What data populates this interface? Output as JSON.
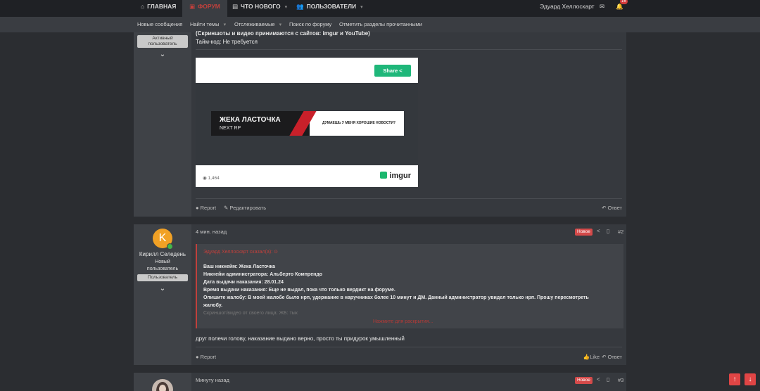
{
  "topnav": {
    "home": "ГЛАВНАЯ",
    "forum": "ФОРУМ",
    "whats_new": "ЧТО НОВОГО",
    "users": "ПОЛЬЗОВАТЕЛИ",
    "username": "Эдуард Хеллоскарт",
    "alerts_count": "16"
  },
  "subnav": {
    "items": [
      "Новые сообщения",
      "Найти темы",
      "Отслеживаемые",
      "Поиск по форуму",
      "Отметить разделы прочитанными"
    ]
  },
  "post1": {
    "user_title": "Активный пользователь",
    "line_top": "(Скриншоты и видео принимаются с сайтов: imgur и YouTube)",
    "line_timecode": "Тайм-код: Не требуется",
    "embed": {
      "share": "Share",
      "banner_title": "ЖЕКА ЛАСТОЧКА",
      "banner_sub": "NEXT RP",
      "banner_tag": "ДУМАЕШЬ У МЕНЯ ХОРОШИЕ НОВОСТИ?",
      "views": "1,464",
      "logo": "imgur"
    },
    "report": "Report",
    "edit": "Редактировать",
    "reply": "Ответ"
  },
  "post2": {
    "avatar_letter": "K",
    "username": "Кирилл Селедень",
    "user_title": "Новый пользователь",
    "user_tag": "Пользователь",
    "time": "4 мин. назад",
    "badge": "Новое",
    "num": "#2",
    "quote": {
      "author": "Эдуард Хеллоскарт сказал(а):",
      "lines": [
        "Ваш никнейм: Жека Ласточка",
        "Никнейм администратора: Альберто Компрендо",
        "Дата выдачи наказания: 28.01.24",
        "Время выдачи наказания: Еще не выдал, пока что только вердикт на форуме.",
        "Опишите жалобу: В моей жалобе было нрп, удержание в наручниках более 10 минут и ДМ. Данный администратор увидел только нрп. Прошу пересмотреть",
        "жалобу.",
        "Скриншот/видео от своего лица: ЖБ: тык"
      ],
      "expand": "Нажмите для раскрытия..."
    },
    "text": "друг полечи голову, наказание выдано верно, просто ты придурок умышленный",
    "report": "Report",
    "like": "Like",
    "reply": "Ответ"
  },
  "post3": {
    "time": "Минуту назад",
    "badge": "Новое",
    "num": "#3"
  }
}
